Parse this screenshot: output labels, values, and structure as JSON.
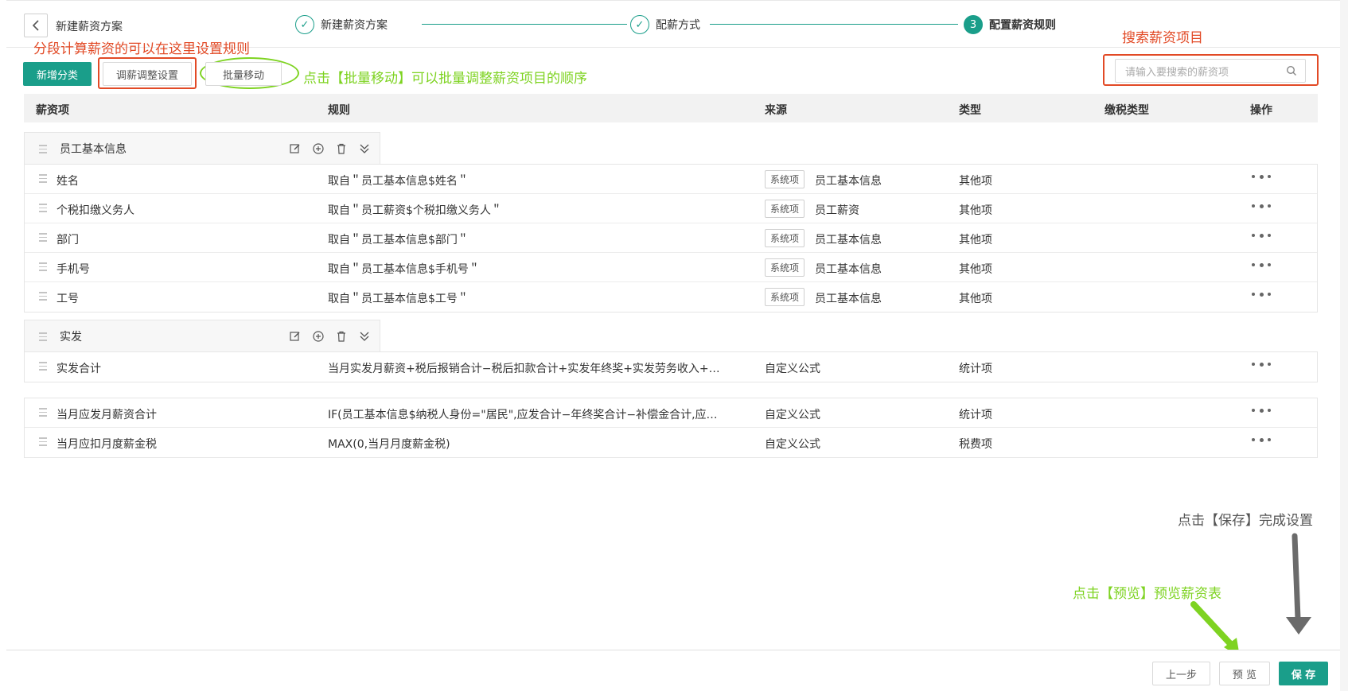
{
  "header": {
    "back_icon": "chevron-left-icon",
    "plan_title": "新建薪资方案",
    "steps": [
      {
        "label": "新建薪资方案",
        "status": "done",
        "marker": "✓"
      },
      {
        "label": "配薪方式",
        "status": "done",
        "marker": "✓"
      },
      {
        "label": "配置薪资规则",
        "status": "active",
        "marker": "3"
      }
    ]
  },
  "annotations": {
    "segment_rule": "分段计算薪资的可以在这里设置规则",
    "batch_move": "点击【批量移动】可以批量调整薪资项目的顺序",
    "search": "搜索薪资项目",
    "save": "点击【保存】完成设置",
    "preview": "点击【预览】预览薪资表"
  },
  "toolbar": {
    "add_category": "新增分类",
    "adjust_setting": "调薪调整设置",
    "batch_move": "批量移动",
    "search_placeholder": "请输入要搜索的薪资项"
  },
  "table": {
    "columns": [
      "薪资项",
      "规则",
      "来源",
      "类型",
      "缴税类型",
      "操作"
    ],
    "groups": [
      {
        "name": "员工基本信息",
        "rows": [
          {
            "item": "姓名",
            "rule": "取自＂员工基本信息$姓名＂",
            "tag": "系统项",
            "source": "员工基本信息",
            "type": "其他项",
            "tax_type": ""
          },
          {
            "item": "个税扣缴义务人",
            "rule": "取自＂员工薪资$个税扣缴义务人＂",
            "tag": "系统项",
            "source": "员工薪资",
            "type": "其他项",
            "tax_type": ""
          },
          {
            "item": "部门",
            "rule": "取自＂员工基本信息$部门＂",
            "tag": "系统项",
            "source": "员工基本信息",
            "type": "其他项",
            "tax_type": ""
          },
          {
            "item": "手机号",
            "rule": "取自＂员工基本信息$手机号＂",
            "tag": "系统项",
            "source": "员工基本信息",
            "type": "其他项",
            "tax_type": ""
          },
          {
            "item": "工号",
            "rule": "取自＂员工基本信息$工号＂",
            "tag": "系统项",
            "source": "员工基本信息",
            "type": "其他项",
            "tax_type": ""
          }
        ]
      },
      {
        "name": "实发",
        "rows": [
          {
            "item": "实发合计",
            "rule": "当月实发月薪资+税后报销合计−税后扣款合计+实发年终奖+实发劳务收入+实发...",
            "tag": "",
            "source": "自定义公式",
            "type": "统计项",
            "tax_type": ""
          }
        ]
      }
    ],
    "ungrouped": [
      {
        "item": "当月应发月薪资合计",
        "rule": "IF(员工基本信息$纳税人身份=\"居民\",应发合计−年终奖合计−补偿金合计,应发合...",
        "tag": "",
        "source": "自定义公式",
        "type": "统计项",
        "tax_type": ""
      },
      {
        "item": "当月应扣月度薪金税",
        "rule": "MAX(0,当月月度薪金税)",
        "tag": "",
        "source": "自定义公式",
        "type": "税费项",
        "tax_type": ""
      }
    ]
  },
  "footer": {
    "prev": "上一步",
    "preview": "预 览",
    "save": "保 存"
  },
  "colors": {
    "accent": "#1a9e8a",
    "annotation_red": "#e24a26",
    "annotation_green": "#7ed321"
  }
}
